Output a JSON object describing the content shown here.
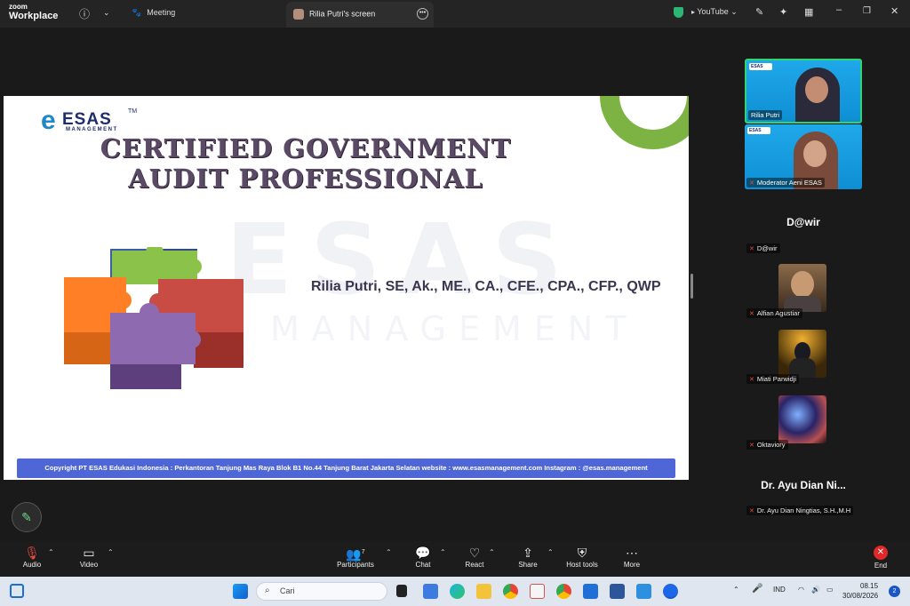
{
  "titlebar": {
    "brand_small": "zoom",
    "brand_big": "Workplace",
    "meeting_tab": "Meeting",
    "screen_tab": "Rilia Putri's screen",
    "youtube_label": "YouTube"
  },
  "slide": {
    "logo_name": "ESAS",
    "logo_tm": "TM",
    "logo_sub": "MANAGEMENT",
    "title_line1": "CERTIFIED GOVERNMENT",
    "title_line2": "AUDIT PROFESSIONAL",
    "presenter": "Rilia Putri, SE, Ak., ME., CA., CFE., CPA., CFP., QWP",
    "watermark": "ESAS",
    "watermark_sub": "MANAGEMENT",
    "footer": "Copyright PT ESAS Edukasi Indonesia : Perkantoran Tanjung Mas Raya Blok B1 No.44 Tanjung Barat Jakarta Selatan website : www.esasmanagement.com Instagram : @esas.management",
    "accent_green": "#7cb342",
    "footer_color": "#4f67d6"
  },
  "participants": {
    "tile1_name": "Rilia Putri",
    "tile2_name": "Moderator Aeni ESAS",
    "dawir_big": "D@wir",
    "dawir_label": "D@wir",
    "alfian_label": "Alfian Agustiar",
    "miati_label": "Miati Parwidji",
    "oktaviory_label": "Oktaviory",
    "ayu_big": "Dr. Ayu Dian Ni...",
    "ayu_label": "Dr. Ayu Dian Ningtias, S.H.,M.H"
  },
  "toolbar": {
    "audio": "Audio",
    "video": "Video",
    "participants": "Participants",
    "participants_count": "7",
    "chat": "Chat",
    "react": "React",
    "share": "Share",
    "host_tools": "Host tools",
    "more": "More",
    "end": "End"
  },
  "taskbar": {
    "search_placeholder": "Cari",
    "lang": "IND",
    "time": "08.15",
    "date": "30/08/2026",
    "notifications": "2"
  }
}
